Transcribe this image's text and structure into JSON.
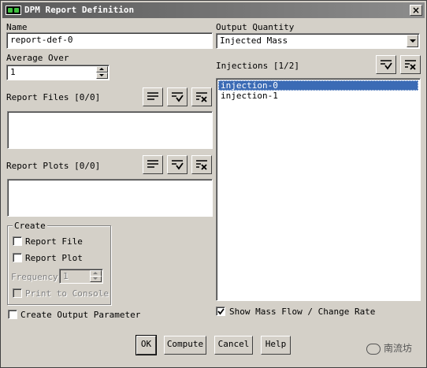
{
  "window": {
    "title": "DPM Report Definition",
    "close_label": "×"
  },
  "name": {
    "label": "Name",
    "value": "report-def-0"
  },
  "average_over": {
    "label": "Average Over",
    "value": "1"
  },
  "report_files": {
    "label": "Report Files [0/0]",
    "items": []
  },
  "report_plots": {
    "label": "Report Plots [0/0]",
    "items": []
  },
  "create": {
    "title": "Create",
    "report_file": {
      "label": "Report File",
      "checked": false
    },
    "report_plot": {
      "label": "Report Plot",
      "checked": false
    },
    "frequency": {
      "label": "Frequency",
      "value": "1"
    },
    "print_to_console": {
      "label": "Print to Console",
      "checked": false
    }
  },
  "create_output_parameter": {
    "label": "Create Output Parameter",
    "checked": false
  },
  "output_quantity": {
    "label": "Output Quantity",
    "value": "Injected Mass"
  },
  "injections": {
    "label": "Injections [1/2]",
    "items": [
      "injection-0",
      "injection-1"
    ],
    "selected": "injection-0"
  },
  "show_mass_flow": {
    "label": "Show Mass Flow / Change Rate",
    "checked": true
  },
  "buttons": {
    "ok": "OK",
    "compute": "Compute",
    "cancel": "Cancel",
    "help": "Help"
  },
  "watermark": {
    "text": "南流坊"
  },
  "colors": {
    "selection": "#3b6bb5",
    "face": "#d4d0c8"
  }
}
